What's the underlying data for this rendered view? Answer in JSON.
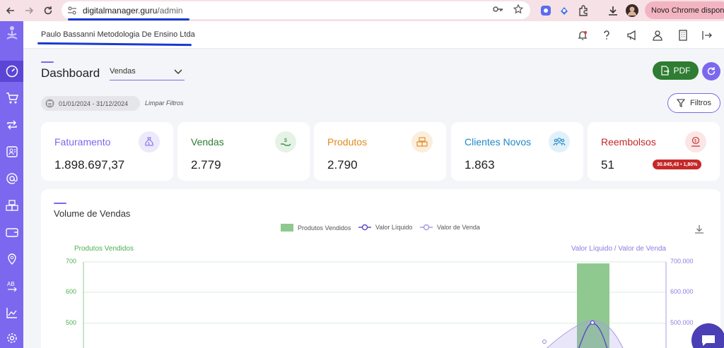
{
  "browser": {
    "url_domain": "digitalmanager.guru",
    "url_path": "/admin",
    "update_label": "Novo Chrome disponível"
  },
  "topbar": {
    "company": "Paulo Bassanni Metodologia De Ensino Ltda"
  },
  "dashboard": {
    "title": "Dashboard",
    "view_select": "Vendas",
    "pdf_label": "PDF",
    "date_range": "01/01/2024 - 31/12/2024",
    "clear_filters": "Limpar Filtros",
    "filters_label": "Filtros"
  },
  "cards": [
    {
      "label": "Faturamento",
      "value": "1.898.697,37",
      "color": "#7b68ee"
    },
    {
      "label": "Vendas",
      "value": "2.779",
      "color": "#2e7d32"
    },
    {
      "label": "Produtos",
      "value": "2.790",
      "color": "#e08a1e"
    },
    {
      "label": "Clientes Novos",
      "value": "1.863",
      "color": "#1e88c8"
    },
    {
      "label": "Reembolsos",
      "value": "51",
      "color": "#c62828",
      "badge": "30.845,43 • 1,80%"
    }
  ],
  "chart": {
    "title": "Volume de Vendas",
    "legend": [
      "Produtos Vendidos",
      "Valor Líquido",
      "Valor de Venda"
    ],
    "left_axis_title": "Produtos Vendidos",
    "right_axis_title": "Valor Líquido / Valor de Venda",
    "left_ticks": [
      "700",
      "600",
      "500"
    ],
    "right_ticks": [
      "700.000",
      "600.000",
      "500.000"
    ],
    "colors": {
      "bars": "#8fc98f",
      "liquido": "#5c4fc9",
      "venda": "#a99be6",
      "left_axis": "#4caf50",
      "right_axis": "#8e7bdf"
    }
  },
  "chart_data": {
    "type": "bar",
    "title": "Volume de Vendas",
    "ylabel": "Produtos Vendidos",
    "y2label": "Valor Líquido / Valor de Venda",
    "ylim_visible": [
      450,
      700
    ],
    "y2lim_visible": [
      450000,
      700000
    ],
    "series": [
      {
        "name": "Produtos Vendidos",
        "type": "bar",
        "axis": "left",
        "visible_values": [
          695
        ]
      },
      {
        "name": "Valor Líquido",
        "type": "line",
        "axis": "right",
        "visible_values": [
          505000
        ]
      },
      {
        "name": "Valor de Venda",
        "type": "line",
        "axis": "right",
        "visible_values": [
          510000
        ]
      }
    ]
  }
}
